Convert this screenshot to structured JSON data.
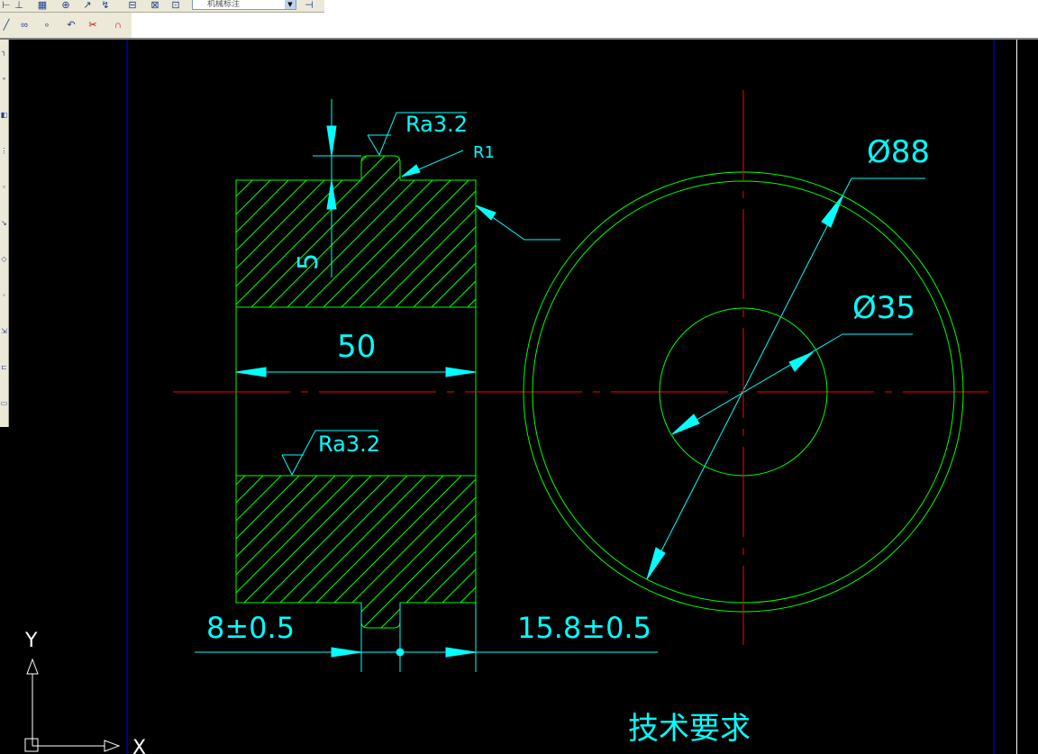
{
  "toolbar": {
    "dimstyle_value": "机械标注",
    "icons_row1": [
      "dim-linear-icon",
      "dim-aligned-icon",
      "table-icon",
      "center-mark-icon",
      "leader-icon",
      "dim-edit-icon",
      "dim-update-icon",
      "dim-style-icon",
      "dim-override-icon"
    ],
    "icons_row2": [
      "line-icon",
      "group-icon",
      "point-icon",
      "arc-tool-icon",
      "trim-icon",
      "magnet-icon"
    ]
  },
  "drawing": {
    "colors": {
      "outline": "#00ff00",
      "dimension": "#00ffff",
      "centerline": "#ff0000",
      "ucs": "#ffffff"
    },
    "dims": {
      "groove_depth": "5",
      "width": "50",
      "offset_left": "8±0.5",
      "offset_right": "15.8±0.5",
      "dia_outer": "Ø88",
      "dia_inner": "Ø35",
      "radius": "R1",
      "roughness_top": "Ra3.2",
      "roughness_mid": "Ra3.2"
    },
    "notes_title": "技术要求",
    "ucs": {
      "x_label": "X",
      "y_label": "Y"
    }
  }
}
